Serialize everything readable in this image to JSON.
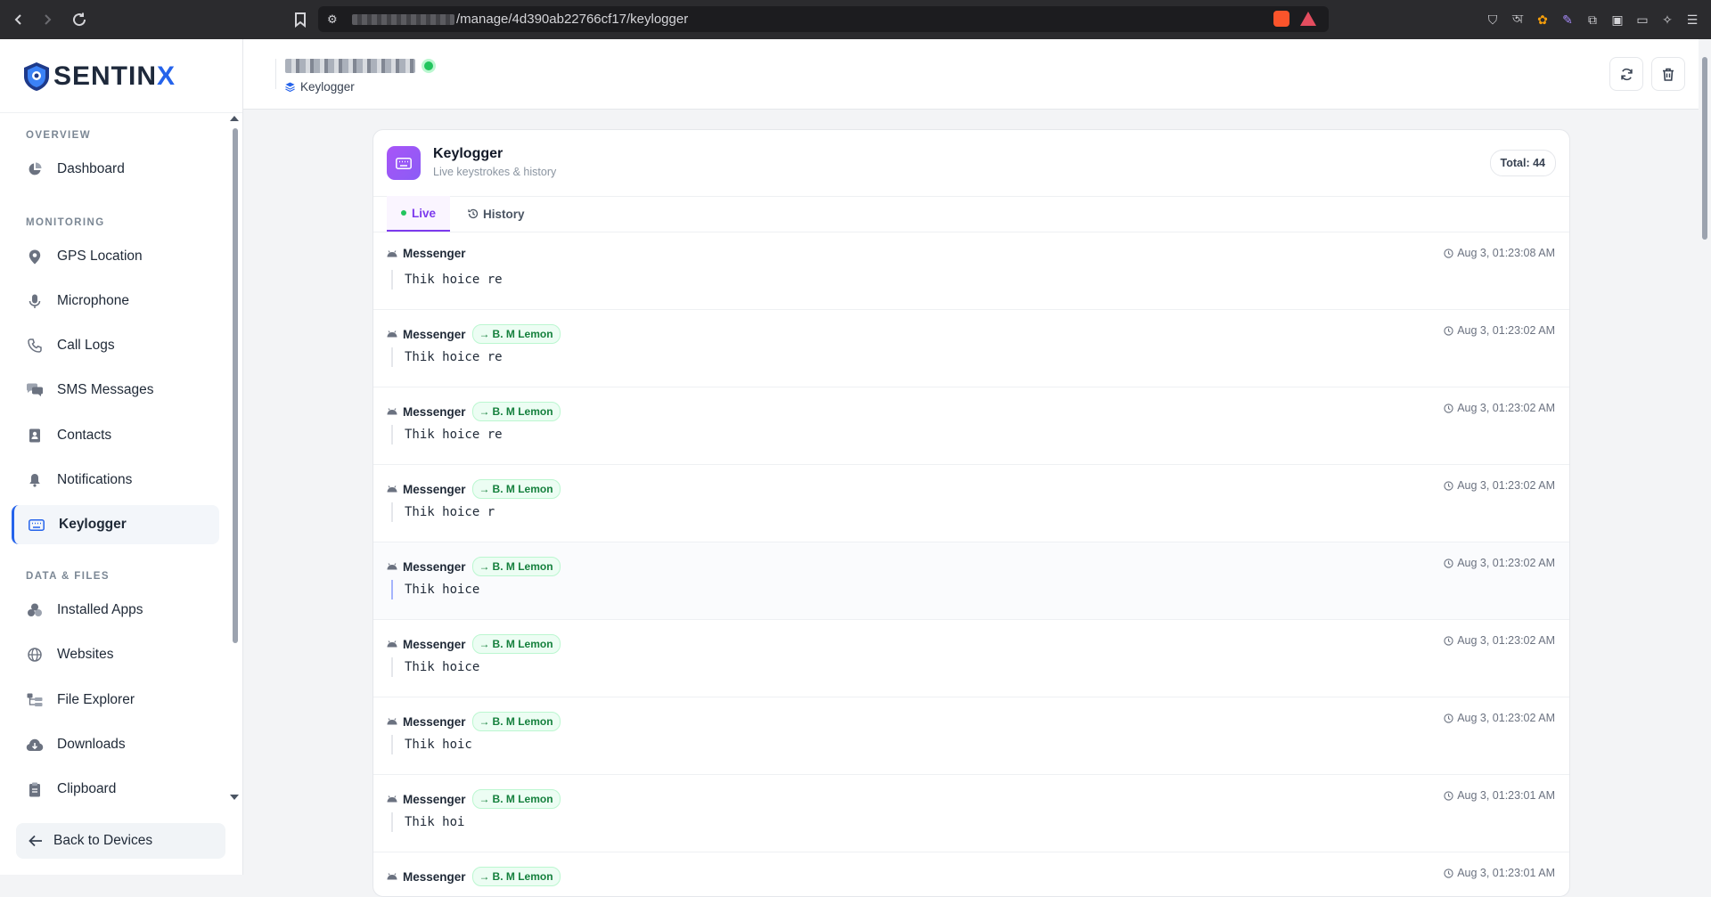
{
  "browser": {
    "url_path": "/manage/4d390ab22766cf17/keylogger"
  },
  "brand": {
    "name_main": "SENTIN",
    "name_accent": "X"
  },
  "sidebar": {
    "sections": {
      "overview": "OVERVIEW",
      "monitoring": "MONITORING",
      "data_files": "DATA & FILES"
    },
    "items": [
      {
        "label": "Dashboard"
      },
      {
        "label": "GPS Location"
      },
      {
        "label": "Microphone"
      },
      {
        "label": "Call Logs"
      },
      {
        "label": "SMS Messages"
      },
      {
        "label": "Contacts"
      },
      {
        "label": "Notifications"
      },
      {
        "label": "Keylogger"
      },
      {
        "label": "Installed Apps"
      },
      {
        "label": "Websites"
      },
      {
        "label": "File Explorer"
      },
      {
        "label": "Downloads"
      },
      {
        "label": "Clipboard"
      }
    ],
    "back_label": "Back to Devices"
  },
  "header": {
    "breadcrumb": "Keylogger"
  },
  "card": {
    "title": "Keylogger",
    "subtitle": "Live keystrokes & history",
    "total": "Total: 44",
    "tabs": {
      "live": "Live",
      "history": "History"
    }
  },
  "entries": [
    {
      "app": "Messenger",
      "contact": "",
      "time": "Aug 3, 01:23:08 AM",
      "text": "Thik hoice re"
    },
    {
      "app": "Messenger",
      "contact": "B. M Lemon",
      "time": "Aug 3, 01:23:02 AM",
      "text": "Thik hoice re"
    },
    {
      "app": "Messenger",
      "contact": "B. M Lemon",
      "time": "Aug 3, 01:23:02 AM",
      "text": "Thik hoice re"
    },
    {
      "app": "Messenger",
      "contact": "B. M Lemon",
      "time": "Aug 3, 01:23:02 AM",
      "text": "Thik hoice r"
    },
    {
      "app": "Messenger",
      "contact": "B. M Lemon",
      "time": "Aug 3, 01:23:02 AM",
      "text": "Thik hoice"
    },
    {
      "app": "Messenger",
      "contact": "B. M Lemon",
      "time": "Aug 3, 01:23:02 AM",
      "text": "Thik hoice"
    },
    {
      "app": "Messenger",
      "contact": "B. M Lemon",
      "time": "Aug 3, 01:23:02 AM",
      "text": "Thik hoic"
    },
    {
      "app": "Messenger",
      "contact": "B. M Lemon",
      "time": "Aug 3, 01:23:01 AM",
      "text": "Thik hoi"
    },
    {
      "app": "Messenger",
      "contact": "B. M Lemon",
      "time": "Aug 3, 01:23:01 AM",
      "text": ""
    }
  ],
  "colors": {
    "accent": "#2563eb",
    "keylogger": "#8b5cf6",
    "online": "#22c55e",
    "contact_badge": "#15803d"
  }
}
